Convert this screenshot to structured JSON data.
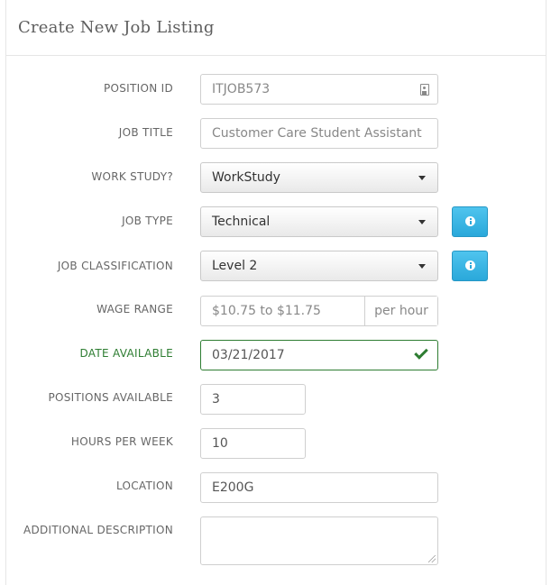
{
  "panel": {
    "title": "Create New Job Listing"
  },
  "form": {
    "position_id": {
      "label": "POSITION ID",
      "value": "ITJOB573",
      "icon": "id-card-icon"
    },
    "job_title": {
      "label": "JOB TITLE",
      "placeholder": "Customer Care Student Assistant"
    },
    "work_study": {
      "label": "WORK STUDY?",
      "selected": "WorkStudy"
    },
    "job_type": {
      "label": "JOB TYPE",
      "selected": "Technical",
      "info_icon": "info-icon"
    },
    "job_classification": {
      "label": "JOB CLASSIFICATION",
      "selected": "Level 2",
      "info_icon": "info-icon"
    },
    "wage_range": {
      "label": "WAGE RANGE",
      "value": "$10.75 to $11.75",
      "addon": "per hour"
    },
    "date_available": {
      "label": "DATE AVAILABLE",
      "value": "03/21/2017",
      "status": "valid",
      "status_color": "#2e7d32"
    },
    "positions_available": {
      "label": "POSITIONS AVAILABLE",
      "value": "3"
    },
    "hours_per_week": {
      "label": "HOURS PER WEEK",
      "value": "10"
    },
    "location": {
      "label": "LOCATION",
      "value": "E200G"
    },
    "additional_description": {
      "label": "ADDITIONAL DESCRIPTION",
      "value": ""
    }
  },
  "colors": {
    "info_button": "#2aa8da",
    "valid": "#2e7d32"
  }
}
